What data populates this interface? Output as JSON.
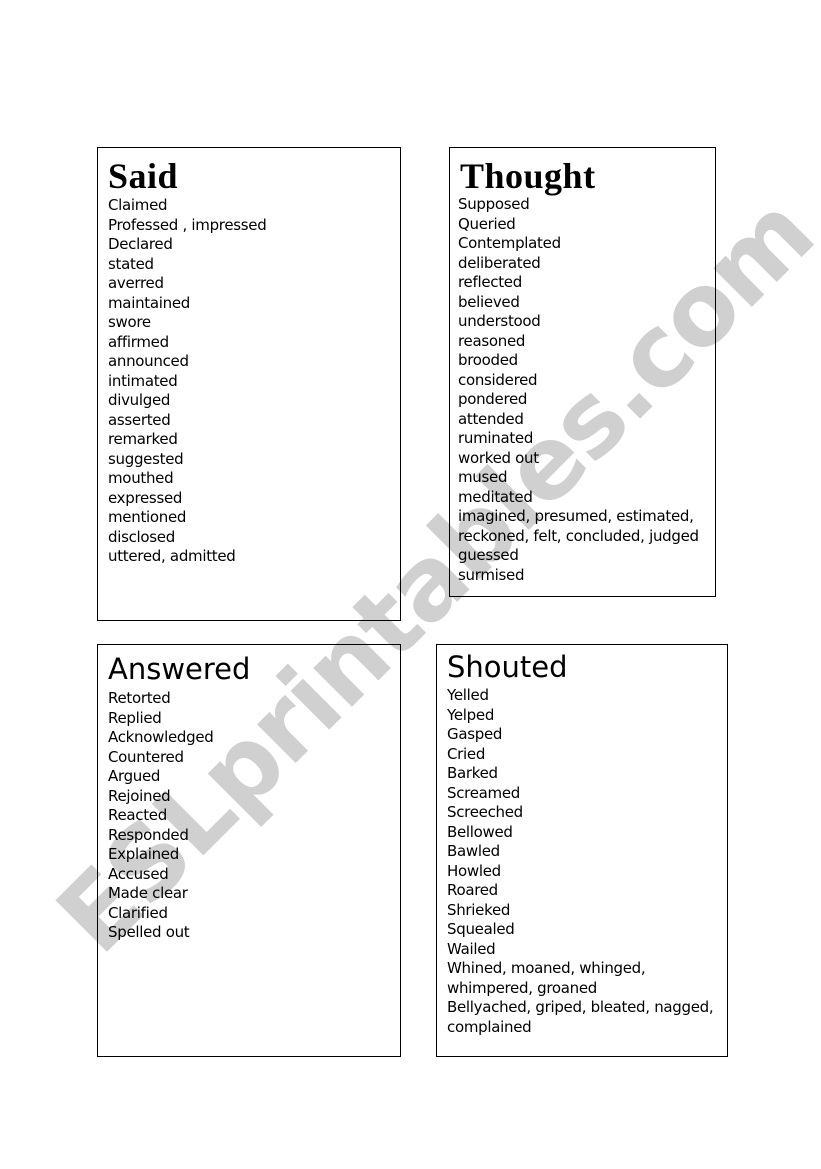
{
  "watermark": "ESLprintables.com",
  "cards": {
    "said": {
      "title": "Said",
      "words": [
        "Claimed",
        "Professed , impressed",
        "Declared",
        "stated",
        "averred",
        "maintained",
        "swore",
        "affirmed",
        "announced",
        "intimated",
        "divulged",
        "asserted",
        "remarked",
        "suggested",
        "mouthed",
        "expressed",
        "mentioned",
        "disclosed",
        "uttered, admitted"
      ]
    },
    "thought": {
      "title": "Thought",
      "words": [
        "Supposed",
        "Queried",
        "Contemplated",
        "deliberated",
        "reflected",
        "believed",
        "understood",
        "reasoned",
        "brooded",
        "considered",
        "pondered",
        "attended",
        "ruminated",
        "worked out",
        "mused",
        "meditated",
        "imagined, presumed, estimated,",
        "reckoned, felt, concluded, judged",
        "guessed",
        "surmised"
      ]
    },
    "answered": {
      "title": "Answered",
      "words": [
        "Retorted",
        "Replied",
        "Acknowledged",
        "Countered",
        "Argued",
        "Rejoined",
        "Reacted",
        "Responded",
        "Explained",
        "Accused",
        "Made clear",
        "Clarified",
        "Spelled out"
      ]
    },
    "shouted": {
      "title": "Shouted",
      "words": [
        "Yelled",
        "Yelped",
        "Gasped",
        "Cried",
        "Barked",
        "Screamed",
        "Screeched",
        "Bellowed",
        "Bawled",
        "Howled",
        "Roared",
        "Shrieked",
        "Squealed",
        "Wailed",
        "Whined, moaned, whinged,",
        "whimpered, groaned",
        "Bellyached,  griped, bleated, nagged,",
        "complained"
      ]
    }
  }
}
